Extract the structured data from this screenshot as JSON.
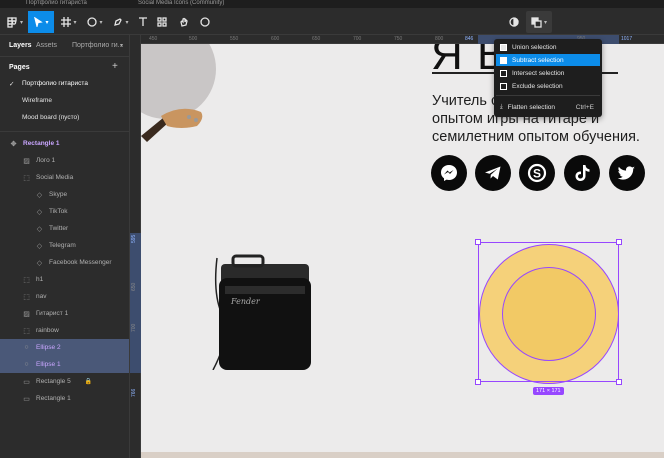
{
  "tabs": [
    "Портфолио гитариста",
    "Social Media Icons (Community)"
  ],
  "left_panel": {
    "tab_layers": "Layers",
    "tab_assets": "Assets",
    "file_name": "Портфолио ги...",
    "pages_title": "Pages",
    "pages": [
      "Портфолио гитариста",
      "Wireframe",
      "Mood board (пусто)"
    ],
    "layers": [
      {
        "label": "Rectangle 1",
        "icon": "frame-icon"
      },
      {
        "label": "Лого 1",
        "icon": "image-icon"
      },
      {
        "label": "Social Media",
        "icon": "group-icon"
      },
      {
        "label": "Skype",
        "icon": "component-icon"
      },
      {
        "label": "TikTok",
        "icon": "component-icon"
      },
      {
        "label": "Twitter",
        "icon": "component-icon"
      },
      {
        "label": "Telegram",
        "icon": "component-icon"
      },
      {
        "label": "Facebook Messenger",
        "icon": "component-icon"
      },
      {
        "label": "h1",
        "icon": "group-icon"
      },
      {
        "label": "nav",
        "icon": "group-icon"
      },
      {
        "label": "Гитарист 1",
        "icon": "image-icon"
      },
      {
        "label": "rainbow",
        "icon": "group-icon"
      },
      {
        "label": "Ellipse 2",
        "icon": "ellipse-icon"
      },
      {
        "label": "Ellipse 1",
        "icon": "ellipse-icon"
      },
      {
        "label": "Rectangle 5",
        "icon": "rectangle-icon"
      },
      {
        "label": "Rectangle 1",
        "icon": "rectangle-icon"
      }
    ]
  },
  "ruler": {
    "h": [
      "450",
      "500",
      "550",
      "600",
      "650",
      "700",
      "750",
      "800",
      "846",
      "950",
      "1017"
    ],
    "v": [
      "595",
      "650",
      "700",
      "766"
    ]
  },
  "canvas": {
    "heading": "Я В... р",
    "subtitle": [
      "Учитель с ... тним",
      "опытом игры на гитаре и",
      "семилетним опытом обучения."
    ],
    "size_badge": "171 × 171",
    "social": [
      "messenger-icon",
      "telegram-icon",
      "skype-icon",
      "tiktok-icon",
      "twitter-icon"
    ],
    "circle_outer": "#f5d17a",
    "circle_inner": "#f2c965",
    "selection_color": "#9747ff"
  },
  "menu": {
    "items": [
      {
        "label": "Union selection",
        "shortcut": ""
      },
      {
        "label": "Subtract selection",
        "shortcut": ""
      },
      {
        "label": "Intersect selection",
        "shortcut": ""
      },
      {
        "label": "Exclude selection",
        "shortcut": ""
      },
      {
        "label": "Flatten selection",
        "shortcut": "Ctrl+E"
      }
    ]
  },
  "colors": {
    "accent": "#0c8ce9",
    "panel": "#2c2c2c",
    "canvas": "#ecebeb"
  }
}
